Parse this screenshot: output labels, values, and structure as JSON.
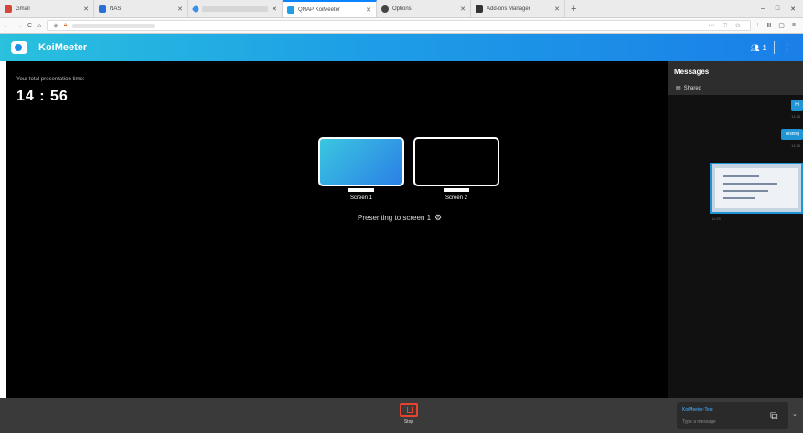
{
  "browser": {
    "tabs": [
      {
        "label": "Gmail",
        "favicon_color": "#d44638",
        "blurred": false,
        "active": false
      },
      {
        "label": "NAS",
        "favicon_color": "#2a6ed8",
        "blurred": false,
        "active": false
      },
      {
        "label": "",
        "favicon_color": "#3b8eea",
        "blurred": true,
        "active": false
      },
      {
        "label": "QNAP KoiMeeter",
        "favicon_color": "#1e9ee6",
        "blurred": false,
        "active": true
      },
      {
        "label": "Options",
        "favicon_color": "#444444",
        "blurred": false,
        "active": false
      },
      {
        "label": "Add-ons Manager",
        "favicon_color": "#333333",
        "blurred": false,
        "active": false
      }
    ],
    "new_tab": "+",
    "window_controls": {
      "minimize": "–",
      "maximize": "□",
      "close": "✕"
    },
    "nav": {
      "back": "←",
      "forward": "→",
      "reload": "C",
      "home": "⌂"
    },
    "url_right_icons": [
      "···",
      "♡",
      "☆"
    ],
    "toolbar_icons": [
      "↓",
      "Ⅲ",
      "▢",
      "≡"
    ]
  },
  "app": {
    "title": "KoiMeeter",
    "participants_count": "1",
    "menu_icon": "⋮",
    "brand_color": "#1e9ee6"
  },
  "stage": {
    "time_label": "Your total presentation time:",
    "time_value": "14 : 56",
    "screens": [
      {
        "label": "Screen 1",
        "active": true
      },
      {
        "label": "Screen 2",
        "active": false
      }
    ],
    "presenting_text": "Presenting to screen 1"
  },
  "messages": {
    "title": "Messages",
    "shared_label": "Shared",
    "items": [
      {
        "text": "Hi",
        "time": "11:25"
      },
      {
        "text": "Testing",
        "time": "11:25"
      }
    ],
    "shared_thumb_time": "11:25"
  },
  "bottom": {
    "stop_label": "Stop",
    "compose_name": "KoiMeeter-Test",
    "compose_placeholder": "Type a message",
    "attach_icon": "⧉",
    "more_icon": "⌄"
  }
}
